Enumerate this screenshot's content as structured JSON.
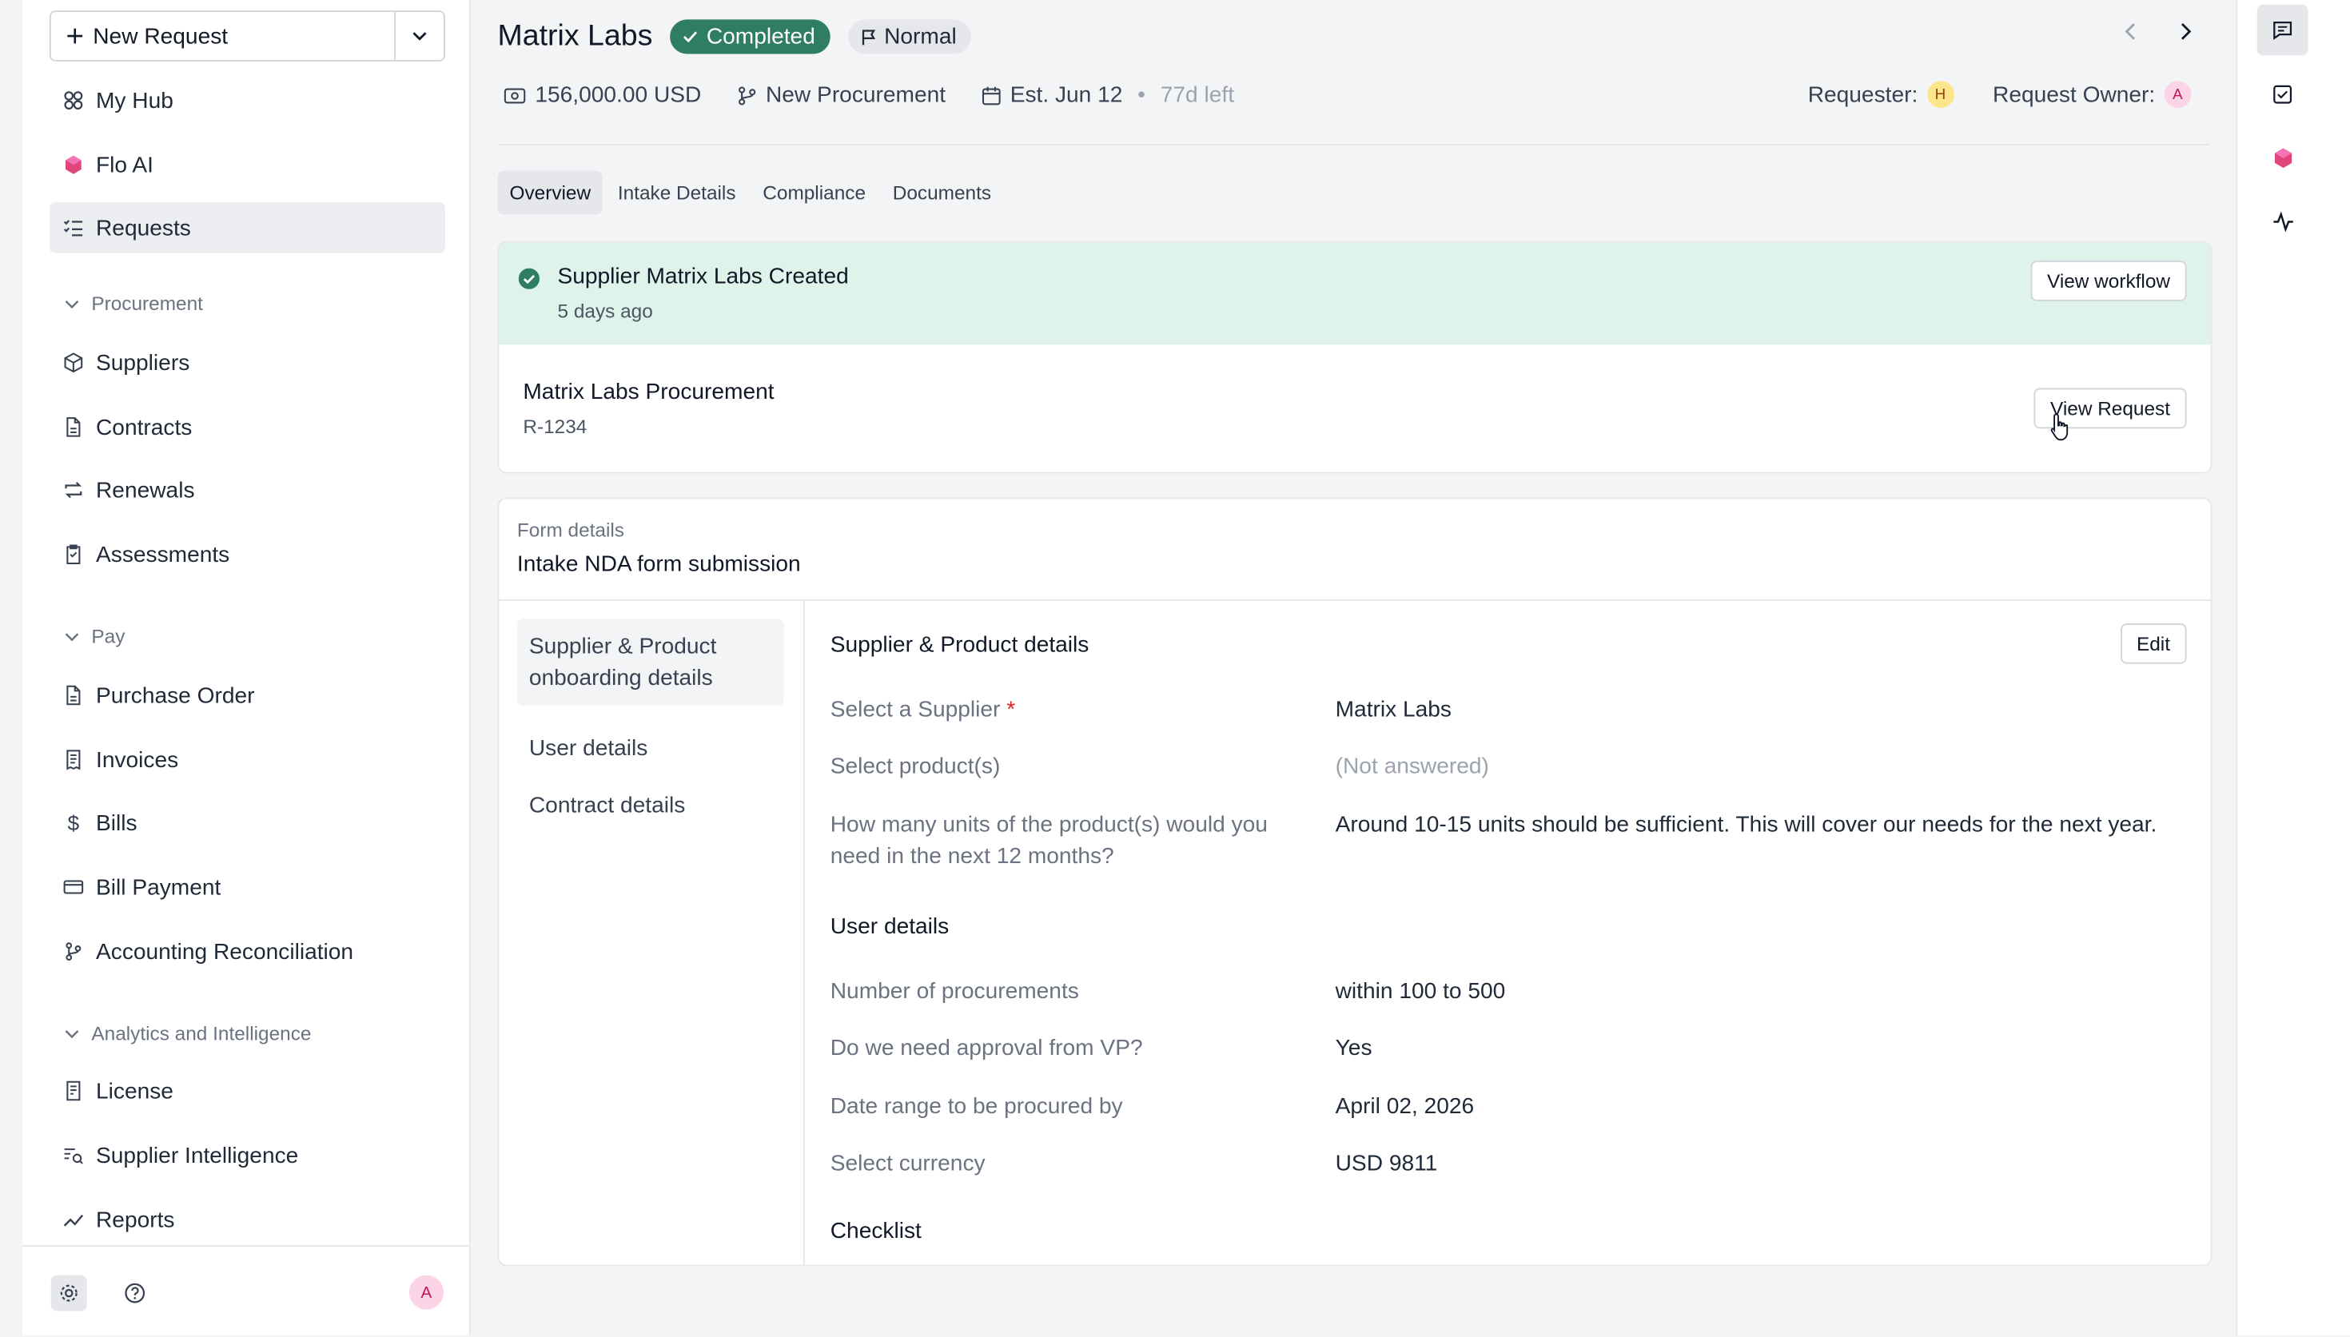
{
  "sidebar": {
    "new_request": "New Request",
    "my_hub": "My Hub",
    "flo_ai": "Flo AI",
    "requests": "Requests",
    "sections": {
      "procurement": "Procurement",
      "pay": "Pay",
      "analytics": "Analytics and Intelligence"
    },
    "procurement_items": [
      "Suppliers",
      "Contracts",
      "Renewals",
      "Assessments"
    ],
    "pay_items": [
      "Purchase Order",
      "Invoices",
      "Bills",
      "Bill Payment",
      "Accounting Reconciliation"
    ],
    "analytics_items": [
      "License",
      "Supplier Intelligence",
      "Reports"
    ],
    "avatar_initial": "A"
  },
  "header": {
    "title": "Matrix Labs",
    "status": "Completed",
    "priority": "Normal",
    "amount": "156,000.00 USD",
    "workflow": "New Procurement",
    "est": "Est. Jun 12",
    "left": "77d left",
    "requester_label": "Requester:",
    "requester_initial": "H",
    "owner_label": "Request Owner:",
    "owner_initial": "A"
  },
  "tabs": [
    "Overview",
    "Intake Details",
    "Compliance",
    "Documents"
  ],
  "activity": {
    "title": "Supplier Matrix Labs Created",
    "time": "5 days ago",
    "view_workflow": "View workflow",
    "request_title": "Matrix Labs Procurement",
    "request_id": "R-1234",
    "view_request": "View Request"
  },
  "form": {
    "caption": "Form details",
    "name": "Intake NDA form submission",
    "sections": [
      "Supplier & Product onboarding details",
      "User details",
      "Contract details"
    ],
    "supplier_heading": "Supplier & Product details",
    "edit": "Edit",
    "required_mark": "*",
    "fields": [
      {
        "label": "Select a Supplier",
        "value": "Matrix Labs"
      },
      {
        "label": "Select product(s)",
        "value": "(Not answered)"
      },
      {
        "label": "How many units of the product(s) would you need in the next 12 months?",
        "value": "Around 10-15 units should be sufficient. This will cover our needs for the next year."
      }
    ],
    "user_heading": "User details",
    "user_fields": [
      {
        "label": "Number of procurements",
        "value": "within 100 to 500"
      },
      {
        "label": "Do we need approval from VP?",
        "value": "Yes"
      },
      {
        "label": "Date range to be procured by",
        "value": "April 02, 2026"
      },
      {
        "label": "Select currency",
        "value": "USD 9811"
      }
    ],
    "checklist_heading": "Checklist"
  },
  "colors": {
    "accent_green": "#2f7d62",
    "success_bg": "#def3ea",
    "required_red": "#dc2626"
  }
}
